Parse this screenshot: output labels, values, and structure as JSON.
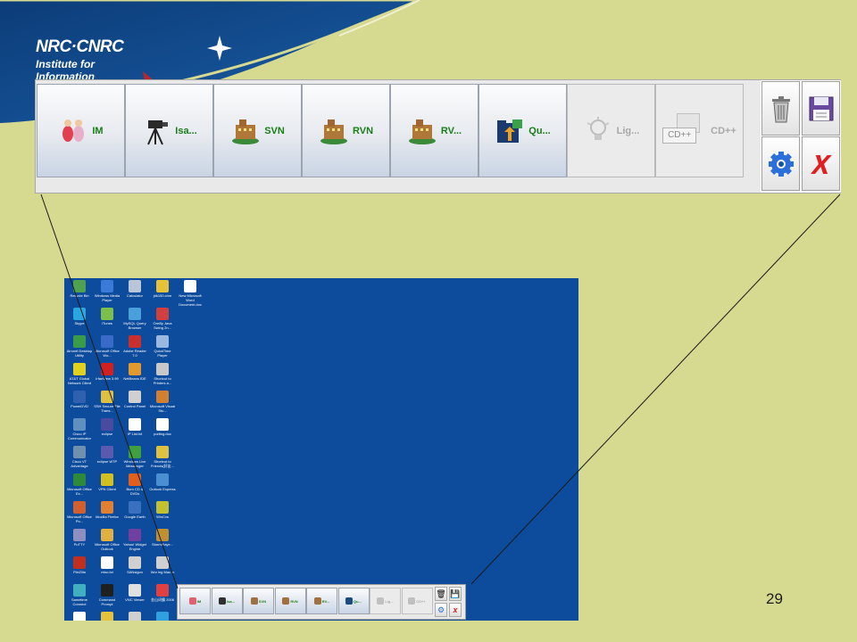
{
  "header": {
    "logo_name": "NRC·CNRC",
    "logo_institute_line1": "Institute for",
    "logo_institute_line2": "Information"
  },
  "toolbar": {
    "buttons": [
      {
        "label": "IM",
        "icon": "im-people-icon",
        "enabled": true
      },
      {
        "label": "Isa...",
        "icon": "camera-tripod-icon",
        "enabled": true
      },
      {
        "label": "SVN",
        "icon": "building-icon",
        "enabled": true
      },
      {
        "label": "RVN",
        "icon": "building-icon",
        "enabled": true
      },
      {
        "label": "RV...",
        "icon": "building-icon",
        "enabled": true
      },
      {
        "label": "Qu...",
        "icon": "folder-upload-icon",
        "enabled": true
      },
      {
        "label": "Lig...",
        "icon": "lightbulb-icon",
        "enabled": false
      },
      {
        "label": "CD++",
        "icon": "cd-folder-icon",
        "enabled": false,
        "icon_text": "CD++"
      }
    ],
    "side_buttons": [
      "trash-icon",
      "save-disk-icon",
      "gear-icon",
      "close-icon"
    ]
  },
  "desktop": {
    "icons": [
      {
        "label": "Recycle Bin",
        "color": "#4fa04f"
      },
      {
        "label": "Windows Media Player",
        "color": "#3b7ad8"
      },
      {
        "label": "Calculator",
        "color": "#b8c6d8"
      },
      {
        "label": "jdk150.chm",
        "color": "#e6c23a"
      },
      {
        "label": "New Microsoft Word Document.doc",
        "color": "#ffffff"
      },
      {
        "label": "Skype",
        "color": "#2aa6e0"
      },
      {
        "label": "iTunes",
        "color": "#7cc04c"
      },
      {
        "label": "MySQL Query Browser",
        "color": "#4aa0d8"
      },
      {
        "label": "Oreilly Java Swing 2n...",
        "color": "#d04040"
      },
      {
        "label": "Aironet Desktop Utility",
        "color": "#3a9c4a"
      },
      {
        "label": "Microsoft Office Wo...",
        "color": "#3a6ac8"
      },
      {
        "label": "Adobe Reader 7.0",
        "color": "#c83030"
      },
      {
        "label": "QuickTime Player",
        "color": "#9ab8e0"
      },
      {
        "label": "AT&T Global Network Client",
        "color": "#e0d020"
      },
      {
        "label": "IrfanView 3.99",
        "color": "#d02020"
      },
      {
        "label": "NetBeans IDE",
        "color": "#e09a30"
      },
      {
        "label": "Shortcut to Printers a...",
        "color": "#c8c8c8"
      },
      {
        "label": "PowerDVD",
        "color": "#3060b0"
      },
      {
        "label": "SSH Secure File Trans...",
        "color": "#e0c040"
      },
      {
        "label": "Control Panel",
        "color": "#d0d0d0"
      },
      {
        "label": "Microsoft Visual Stu...",
        "color": "#d08030"
      },
      {
        "label": "Cisco IP Communicator",
        "color": "#6090c0"
      },
      {
        "label": "eclipse",
        "color": "#4a4aa0"
      },
      {
        "label": "IP List.txt",
        "color": "#ffffff"
      },
      {
        "label": "porting.doc",
        "color": "#ffffff"
      },
      {
        "label": "Cisco VT Advantage",
        "color": "#7090b0"
      },
      {
        "label": "eclipse WTP",
        "color": "#5a5ab0"
      },
      {
        "label": "Windows Live Messenger",
        "color": "#40a040"
      },
      {
        "label": "Shortcut to Friends(好友...",
        "color": "#e0c040"
      },
      {
        "label": "Microsoft Office Ex...",
        "color": "#2e8a3a"
      },
      {
        "label": "VPN Client",
        "color": "#d0c020"
      },
      {
        "label": "Burn CD & DVDs",
        "color": "#e06020"
      },
      {
        "label": "Outlook Express",
        "color": "#4a90d0"
      },
      {
        "label": "Microsoft Office Po...",
        "color": "#d06030"
      },
      {
        "label": "Mozilla Firefox",
        "color": "#e08030"
      },
      {
        "label": "Google Earth",
        "color": "#3a70c0"
      },
      {
        "label": "WinCvs",
        "color": "#c0c030"
      },
      {
        "label": "PuTTY",
        "color": "#9090c0"
      },
      {
        "label": "Microsoft Office Outlook",
        "color": "#e0b040"
      },
      {
        "label": "Yahoo! Widget Engine",
        "color": "#7040a0"
      },
      {
        "label": "StormPlaye...",
        "color": "#c09030"
      },
      {
        "label": "FileZilla",
        "color": "#c03020"
      },
      {
        "label": "misc.txt",
        "color": "#ffffff"
      },
      {
        "label": "SANsigon",
        "color": "#d0d0d0"
      },
      {
        "label": "Wor ing Mac in",
        "color": "#d0d0d0"
      },
      {
        "label": "Sametime Connect",
        "color": "#40b0c0"
      },
      {
        "label": "Command Prompt",
        "color": "#202020"
      },
      {
        "label": "VNC Viewer",
        "color": "#e0e0e0"
      },
      {
        "label": "金山词霸 2006",
        "color": "#e04040"
      },
      {
        "label": "logo.txt",
        "color": "#ffffff"
      },
      {
        "label": "Shortcut to jdk150.chm",
        "color": "#e6c23a"
      },
      {
        "label": "SSH Secure Shell Client",
        "color": "#d0d0d0"
      },
      {
        "label": "腾讯QQ",
        "color": "#30a0e0"
      }
    ],
    "mini_toolbar": {
      "buttons": [
        {
          "label": "IM",
          "enabled": true,
          "color": "#e06070"
        },
        {
          "label": "Isa...",
          "enabled": true,
          "color": "#303030"
        },
        {
          "label": "SVN",
          "enabled": true,
          "color": "#a07040"
        },
        {
          "label": "RVN",
          "enabled": true,
          "color": "#a07040"
        },
        {
          "label": "RV...",
          "enabled": true,
          "color": "#a07040"
        },
        {
          "label": "Qu...",
          "enabled": true,
          "color": "#1a4a80"
        },
        {
          "label": "Lig...",
          "enabled": false,
          "color": "#c0c0c0"
        },
        {
          "label": "CD++",
          "enabled": false,
          "color": "#c0c0c0"
        }
      ]
    }
  },
  "page_number": "29"
}
